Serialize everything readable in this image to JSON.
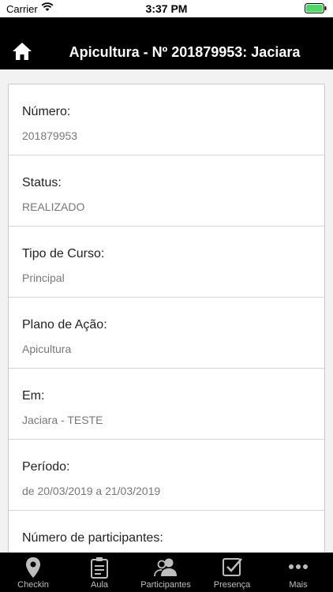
{
  "status_bar": {
    "carrier": "Carrier",
    "time": "3:37 PM"
  },
  "nav": {
    "title": "Apicultura - Nº 201879953: Jaciara",
    "home_icon": "home-icon"
  },
  "fields": [
    {
      "label": "Número:",
      "value": "201879953"
    },
    {
      "label": "Status:",
      "value": "REALIZADO"
    },
    {
      "label": "Tipo de Curso:",
      "value": "Principal"
    },
    {
      "label": "Plano de Ação:",
      "value": "Apicultura"
    },
    {
      "label": "Em:",
      "value": "Jaciara - TESTE"
    },
    {
      "label": "Período:",
      "value": "de 20/03/2019 a 21/03/2019"
    },
    {
      "label": "Número de participantes:",
      "value": ""
    }
  ],
  "tabs": [
    {
      "label": "Checkin",
      "icon": "map-pin-icon"
    },
    {
      "label": "Aula",
      "icon": "clipboard-icon"
    },
    {
      "label": "Participantes",
      "icon": "users-icon"
    },
    {
      "label": "Presença",
      "icon": "checkbox-icon"
    },
    {
      "label": "Mais",
      "icon": "more-icon"
    }
  ],
  "colors": {
    "nav_background": "#000000",
    "tab_background": "#000000",
    "page_background": "#f2f2f2"
  }
}
